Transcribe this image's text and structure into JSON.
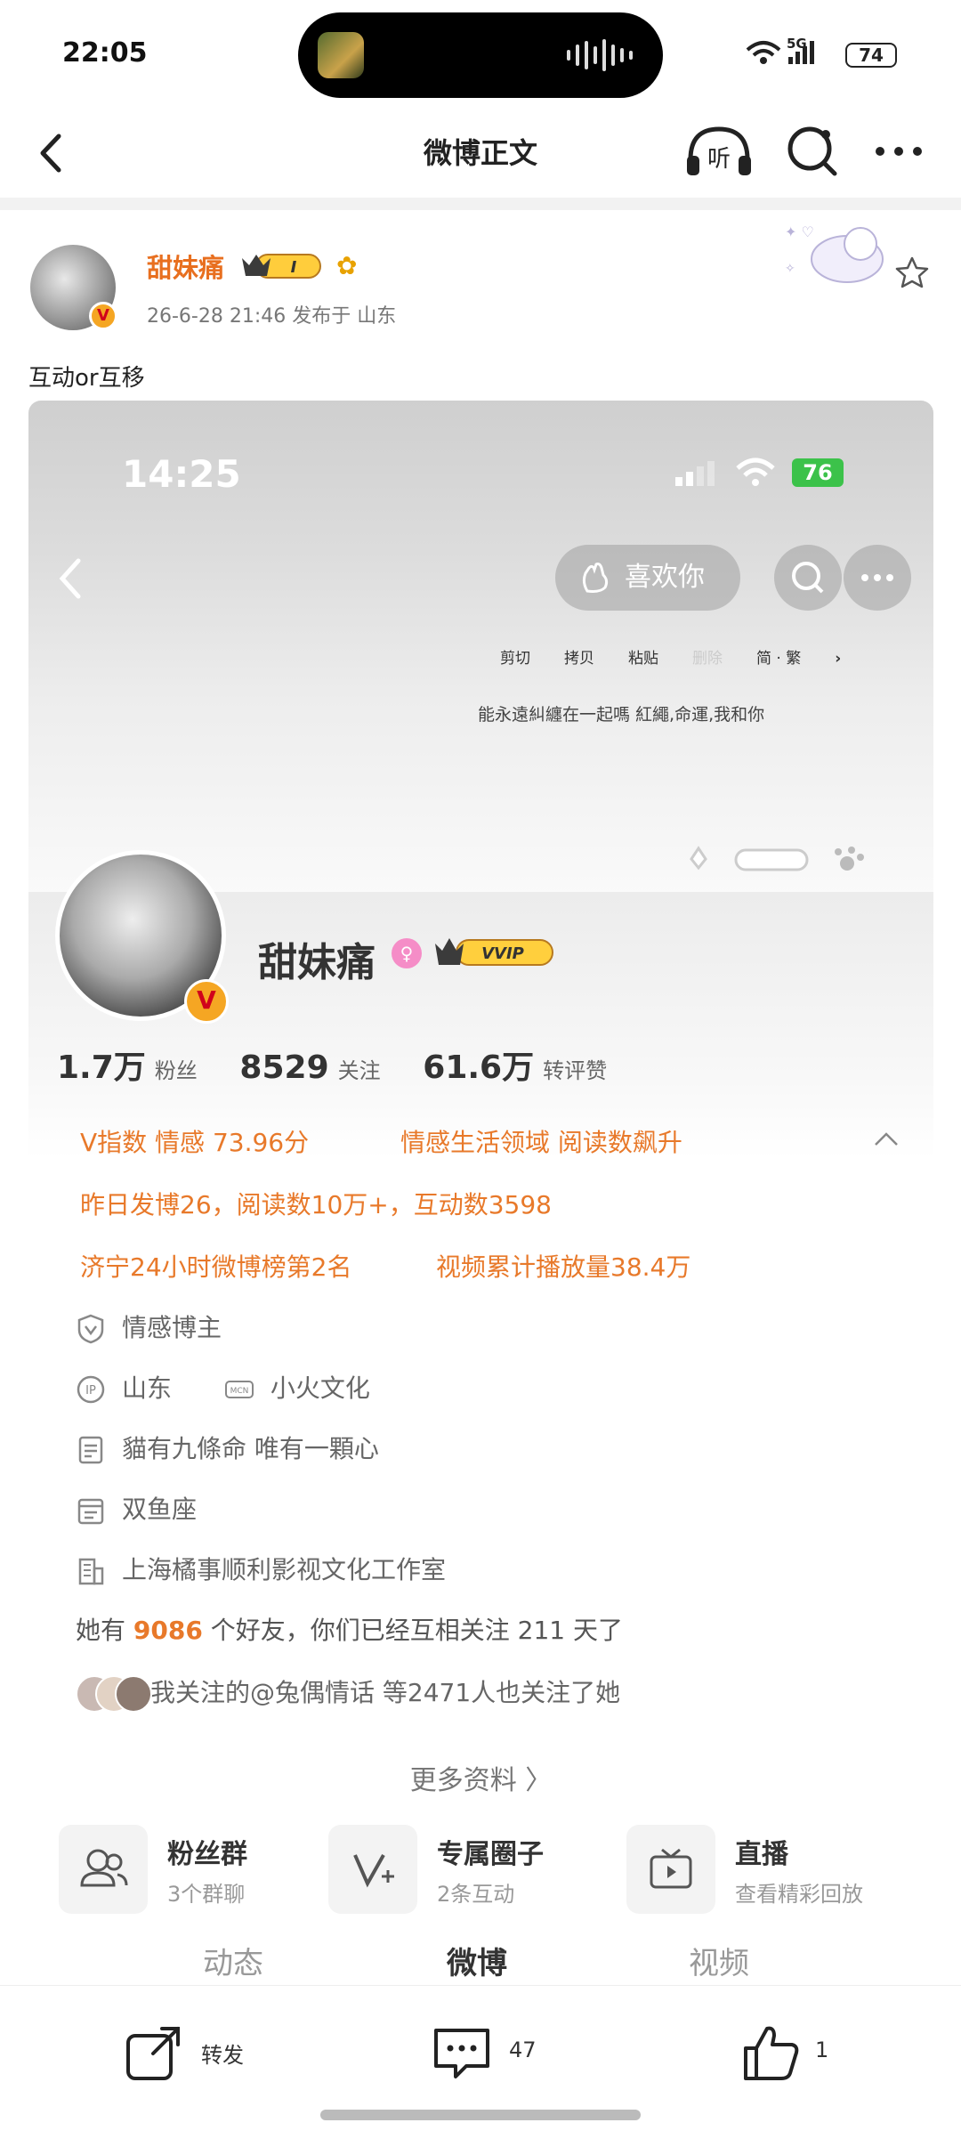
{
  "status_bar": {
    "time": "22:05",
    "network": "5G",
    "battery": "74"
  },
  "nav": {
    "title": "微博正文",
    "listen_label": "听"
  },
  "post": {
    "author": "甜妹痛",
    "meta": "26-6-28 21:46   发布于 山东",
    "text": "互动or互移"
  },
  "embed": {
    "status_time": "14:25",
    "status_battery": "76",
    "like_label": "喜欢你",
    "context_menu": [
      "剪切",
      "拷贝",
      "粘贴",
      "删除",
      "简 · 繁"
    ],
    "signature": "能永遠糾纏在一起嗎  紅繩,命運,我和你",
    "profile": {
      "name": "甜妹痛",
      "vvip": "VVIP",
      "fans_count": "1.7万",
      "fans_label": "粉丝",
      "follow_count": "8529",
      "follow_label": "关注",
      "likes_count": "61.6万",
      "likes_label": "转评赞",
      "vindex": "V指数 情感 73.96分",
      "field": "情感生活领域 阅读数飙升",
      "yesterday": "昨日发博26，阅读数10万+，互动数3598",
      "rank": "济宁24小时微博榜第2名",
      "video": "视频累计播放量38.4万",
      "role": "情感博主",
      "ip": "山东",
      "mcn": "小火文化",
      "bio": "貓有九條命 唯有一顆心",
      "zodiac": "双鱼座",
      "company": "上海橘事顺利影视文化工作室",
      "friends_pre": "她有 ",
      "friends_num": "9086",
      "friends_post": " 个好友，你们已经互相关注 211 天了",
      "mutual": "我关注的@兔偶情话 等2471人也关注了她",
      "more": "更多资料 〉",
      "tiles": [
        {
          "title": "粉丝群",
          "sub": "3个群聊"
        },
        {
          "title": "专属圈子",
          "sub": "2条互动"
        },
        {
          "title": "直播",
          "sub": "查看精彩回放"
        }
      ],
      "tabs": [
        "动态",
        "微博",
        "视频"
      ]
    }
  },
  "actions": {
    "repost": "转发",
    "comments": "47",
    "likes": "1"
  },
  "colors": {
    "accent": "#e8792a",
    "author": "#e86f1f"
  }
}
